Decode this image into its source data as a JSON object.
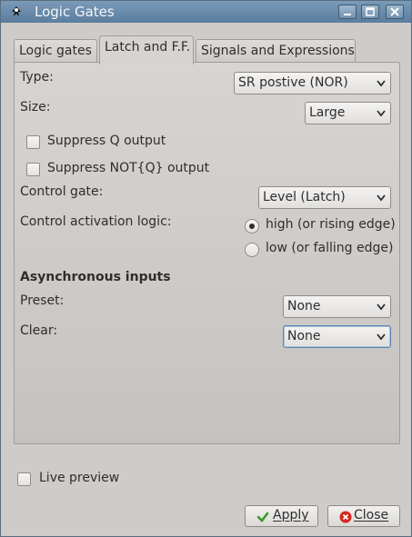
{
  "window": {
    "title": "Logic Gates",
    "icon": "inkscape-icon",
    "controls": [
      "minimize-icon",
      "maximize-icon",
      "close-icon"
    ]
  },
  "tabs": [
    {
      "label": "Logic gates",
      "active": false
    },
    {
      "label": "Latch and F.F.",
      "active": true
    },
    {
      "label": "Signals and Expressions",
      "active": false
    }
  ],
  "form": {
    "type": {
      "label": "Type:",
      "value": "SR postive (NOR)"
    },
    "size": {
      "label": "Size:",
      "value": "Large"
    },
    "suppress_q": {
      "label": "Suppress Q output",
      "checked": false
    },
    "suppress_not_q": {
      "label": "Suppress NOT{Q} output",
      "checked": false
    },
    "control_gate": {
      "label": "Control gate:",
      "value": "Level (Latch)"
    },
    "control_logic": {
      "label": "Control activation logic:",
      "options": [
        {
          "label": "high (or rising edge)",
          "selected": true
        },
        {
          "label": "low (or falling edge)",
          "selected": false
        }
      ]
    },
    "async_heading": "Asynchronous inputs",
    "preset": {
      "label": "Preset:",
      "value": "None"
    },
    "clear": {
      "label": "Clear:",
      "value": "None"
    }
  },
  "live_preview": {
    "label": "Live preview",
    "checked": false
  },
  "buttons": {
    "apply": {
      "mnemonic": "A",
      "rest": "pply",
      "icon": "checkmark-icon"
    },
    "close": {
      "mnemonic": "C",
      "rest": "lose",
      "icon": "close-circle-icon"
    }
  },
  "colors": {
    "titlebar": "#6a8bab",
    "apply_icon": "#3a9a2a",
    "close_icon": "#d42a1e"
  }
}
